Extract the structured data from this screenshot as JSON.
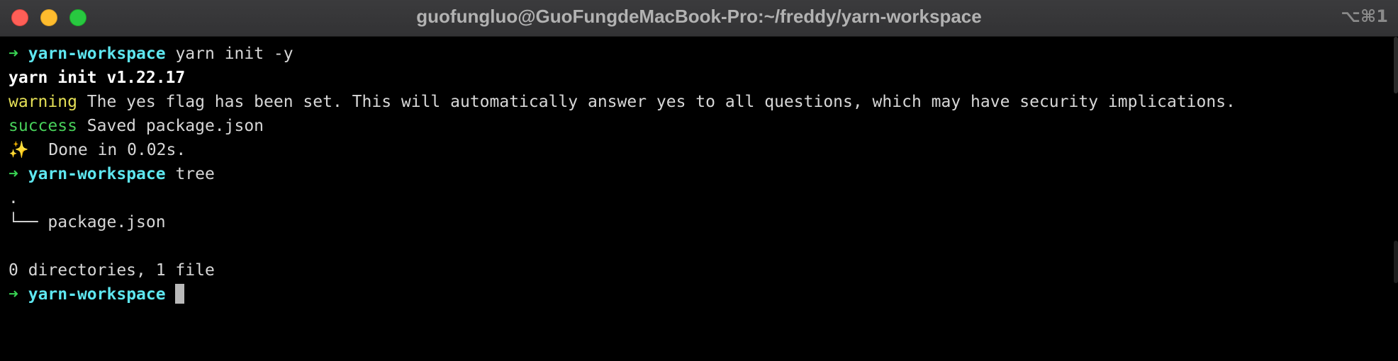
{
  "window": {
    "title": "guofungluo@GuoFungdeMacBook-Pro:~/freddy/yarn-workspace",
    "shortcut": "⌥⌘1"
  },
  "terminal": {
    "prompt_arrow": "➜",
    "prompt_dir": "yarn-workspace",
    "cmd1": "yarn init -y",
    "yarn_version_line": "yarn init v1.22.17",
    "warning_label": "warning",
    "warning_text": " The yes flag has been set. This will automatically answer yes to all questions, which may have security implications.",
    "success_label": "success",
    "success_text": " Saved package.json",
    "done_line": "✨  Done in 0.02s.",
    "cmd2": "tree",
    "tree_root": ".",
    "tree_entry": "└── package.json",
    "tree_summary": "0 directories, 1 file",
    "cmd3": ""
  },
  "colors": {
    "background": "#000000",
    "prompt_arrow": "#39d353",
    "prompt_dir": "#5ee6ef",
    "warning": "#e5e056",
    "success": "#48d05a"
  }
}
